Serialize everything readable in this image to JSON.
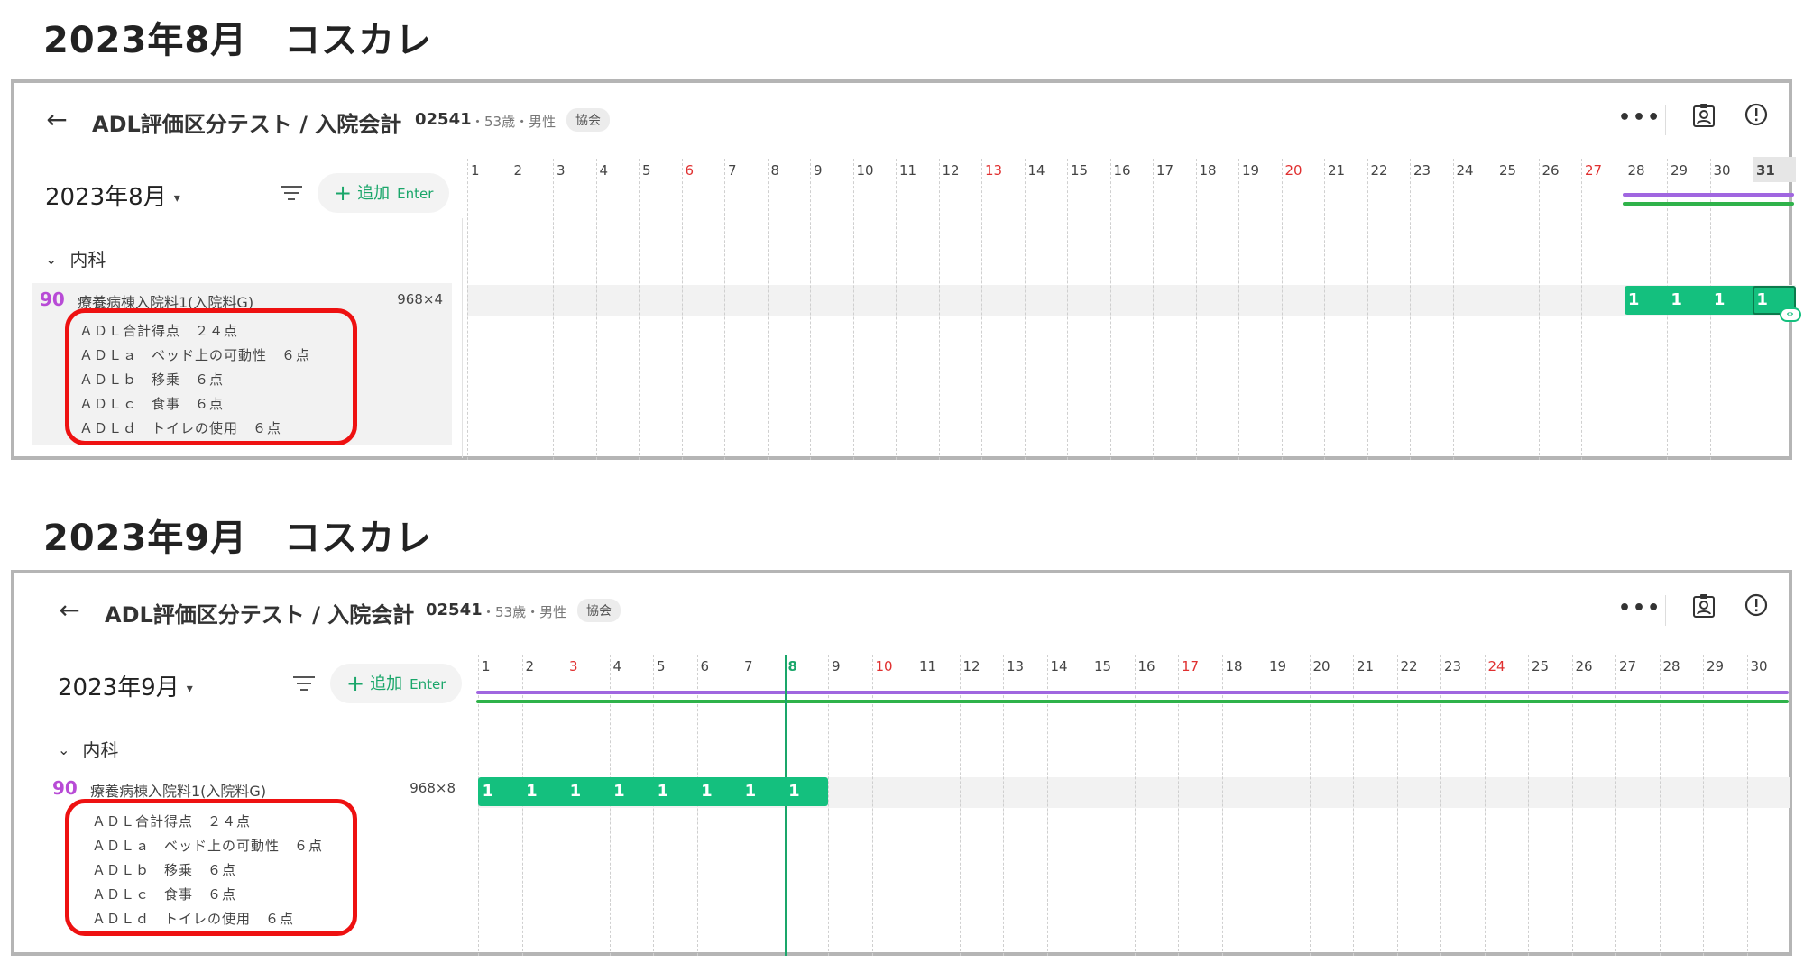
{
  "sections": [
    {
      "title": "2023年8月　コスカレ",
      "header": {
        "page_title": "ADL評価区分テスト / 入院会計",
        "patient_id": "02541",
        "patient_info": "・53歳・男性",
        "badge": "協会"
      },
      "month_label": "2023年8月",
      "add_button": {
        "label": "追加",
        "shortcut": "Enter"
      },
      "department": "内科",
      "item": {
        "code": "90",
        "name": "療養病棟入院料1(入院料G)",
        "amount": "968×4"
      },
      "adl_lines": [
        "ＡＤＬ合計得点　２４点",
        "ＡＤＬａ　ベッド上の可動性　６点",
        "ＡＤＬｂ　移乗　６点",
        "ＡＤＬｃ　食事　６点",
        "ＡＤＬｄ　トイレの使用　６点"
      ],
      "calendar": {
        "days": [
          "1",
          "2",
          "3",
          "4",
          "5",
          "6",
          "7",
          "8",
          "9",
          "10",
          "11",
          "12",
          "13",
          "14",
          "15",
          "16",
          "17",
          "18",
          "19",
          "20",
          "21",
          "22",
          "23",
          "24",
          "25",
          "26",
          "27",
          "28",
          "29",
          "30",
          "31"
        ],
        "holidays": [
          6,
          13,
          20,
          27
        ],
        "current_day": 31,
        "today_marker": null,
        "range_start_day": 28,
        "range_end_day": 31,
        "pill_start_day": 28,
        "pill_values": [
          "1",
          "1",
          "1",
          "1"
        ],
        "selected_day": 31
      }
    },
    {
      "title": "2023年9月　コスカレ",
      "header": {
        "page_title": "ADL評価区分テスト / 入院会計",
        "patient_id": "02541",
        "patient_info": "・53歳・男性",
        "badge": "協会"
      },
      "month_label": "2023年9月",
      "add_button": {
        "label": "追加",
        "shortcut": "Enter"
      },
      "department": "内科",
      "item": {
        "code": "90",
        "name": "療養病棟入院料1(入院料G)",
        "amount": "968×8"
      },
      "adl_lines": [
        "ＡＤＬ合計得点　２４点",
        "ＡＤＬａ　ベッド上の可動性　６点",
        "ＡＤＬｂ　移乗　６点",
        "ＡＤＬｃ　食事　６点",
        "ＡＤＬｄ　トイレの使用　６点"
      ],
      "calendar": {
        "days": [
          "1",
          "2",
          "3",
          "4",
          "5",
          "6",
          "7",
          "8",
          "9",
          "10",
          "11",
          "12",
          "13",
          "14",
          "15",
          "16",
          "17",
          "18",
          "19",
          "20",
          "21",
          "22",
          "23",
          "24",
          "25",
          "26",
          "27",
          "28",
          "29",
          "30"
        ],
        "holidays": [
          3,
          10,
          17,
          24
        ],
        "current_day": null,
        "today_marker": 8,
        "range_start_day": 1,
        "range_end_day": 30,
        "pill_start_day": 1,
        "pill_values": [
          "1",
          "1",
          "1",
          "1",
          "1",
          "1",
          "1",
          "1"
        ],
        "selected_day": null
      }
    }
  ],
  "icons": {
    "back": "arrow-left-icon",
    "more": "more-horizontal-icon",
    "patient_card": "id-card-icon",
    "alert": "alert-circle-icon",
    "filter": "filter-lines-icon",
    "plus": "plus-icon",
    "caret": "caret-down-icon",
    "chevron": "chevron-down-icon"
  },
  "colors": {
    "accent_green": "#14c07e",
    "range_purple": "#a066e0",
    "range_green": "#2fb24a",
    "holiday_red": "#e03030",
    "highlight_red": "#ee1111",
    "item_code_purple": "#b84bd6"
  }
}
